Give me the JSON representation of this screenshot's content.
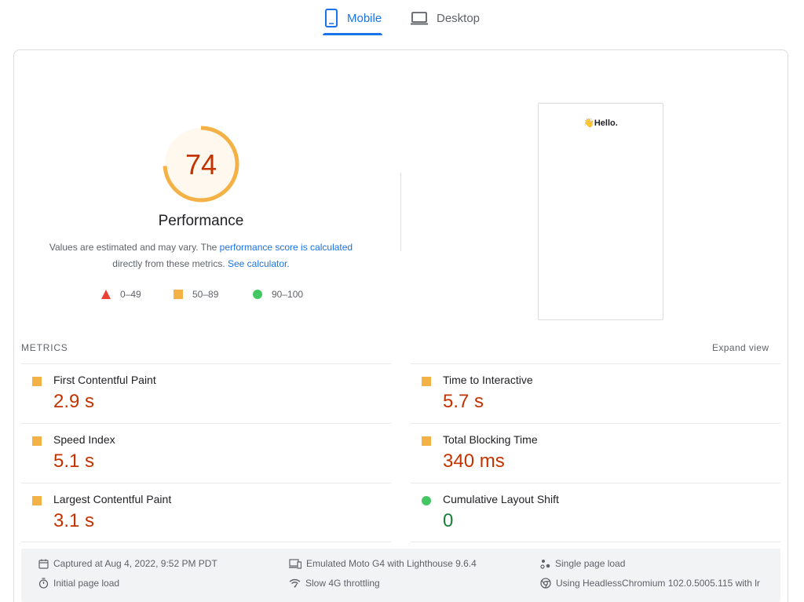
{
  "tabs": {
    "mobile_label": "Mobile",
    "desktop_label": "Desktop",
    "active": "mobile"
  },
  "score": {
    "value": 74,
    "fraction": 0.74,
    "title": "Performance",
    "color_ring": "#f4b146",
    "color_text": "#c33300"
  },
  "description": {
    "part1": "Values are estimated and may vary. The ",
    "link1": "performance score is calculated",
    "part2": "directly from these metrics. ",
    "link2": "See calculator."
  },
  "legend": {
    "fail": "0–49",
    "average": "50–89",
    "pass": "90–100"
  },
  "preview": {
    "text": "👋Hello."
  },
  "metrics": {
    "label": "METRICS",
    "expand_label": "Expand view",
    "items": [
      {
        "name": "First Contentful Paint",
        "value": "2.9 s",
        "rating": "average"
      },
      {
        "name": "Time to Interactive",
        "value": "5.7 s",
        "rating": "average"
      },
      {
        "name": "Speed Index",
        "value": "5.1 s",
        "rating": "average"
      },
      {
        "name": "Total Blocking Time",
        "value": "340 ms",
        "rating": "average"
      },
      {
        "name": "Largest Contentful Paint",
        "value": "3.1 s",
        "rating": "average"
      },
      {
        "name": "Cumulative Layout Shift",
        "value": "0",
        "rating": "pass"
      }
    ]
  },
  "footer": {
    "captured": "Captured at Aug 4, 2022, 9:52 PM PDT",
    "initial_load": "Initial page load",
    "device": "Emulated Moto G4 with Lighthouse 9.6.4",
    "throttling": "Slow 4G throttling",
    "single_load": "Single page load",
    "browser": "Using HeadlessChromium 102.0.5005.115 with lr"
  },
  "colors": {
    "accent": "#1a73e8",
    "fail": "#eb4034",
    "average": "#f4b146",
    "pass": "#44c762"
  }
}
